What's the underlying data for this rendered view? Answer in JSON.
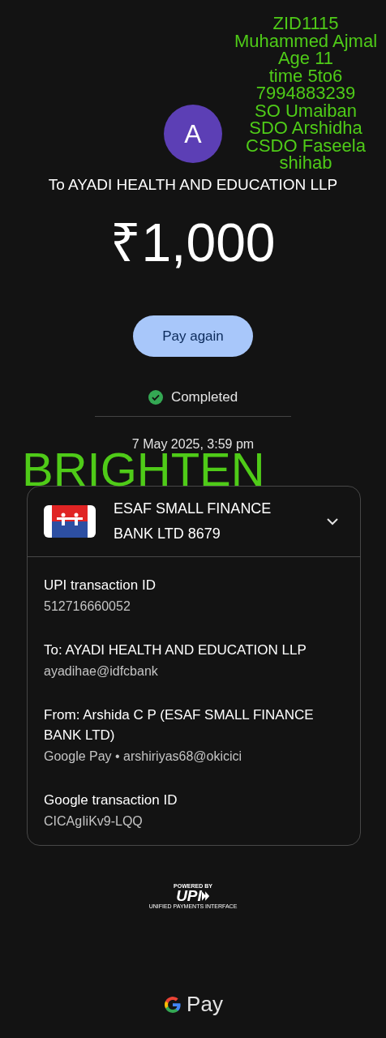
{
  "payee": {
    "avatar_letter": "A",
    "title": "To AYADI HEALTH AND EDUCATION LLP",
    "amount": "₹1,000"
  },
  "pay_again_button": "Pay again",
  "status": {
    "label": "Completed",
    "kind": "success"
  },
  "date": "7 May 2025, 3:59 pm",
  "account_card": {
    "bank_name": "ESAF SMALL FINANCE BANK LTD 8679",
    "expanded": true,
    "details": [
      {
        "label": "UPI transaction ID",
        "value": "512716660052"
      },
      {
        "label": "To: AYADI HEALTH AND EDUCATION LLP",
        "value": "ayadihae@idfcbank"
      },
      {
        "label": "From: Arshida C P (ESAF SMALL FINANCE BANK LTD)",
        "value": "Google Pay • arshiriyas68@okicici"
      },
      {
        "label": "Google transaction ID",
        "value": "CICAgIiKv9-LQQ"
      }
    ]
  },
  "upi_badge": {
    "top": "POWERED BY",
    "logo": "UPI",
    "bottom": "UNIFIED PAYMENTS INTERFACE"
  },
  "footer_logo": "Pay",
  "annotation": {
    "lines": [
      "ZID1115",
      "Muhammed Ajmal",
      "Age 11",
      "time 5to6",
      "7994883239",
      "SO Umaiban",
      "SDO Arshidha",
      "CSDO Faseela",
      "shihab"
    ],
    "tag": "BRIGHTEN"
  }
}
